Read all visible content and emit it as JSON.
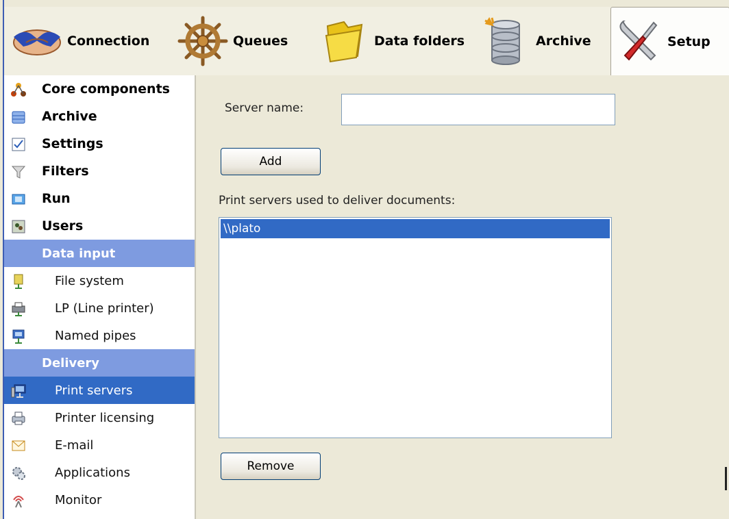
{
  "toolbar": {
    "items": [
      {
        "label": "Connection",
        "icon": "handshake-icon"
      },
      {
        "label": "Queues",
        "icon": "ship-wheel-icon"
      },
      {
        "label": "Data folders",
        "icon": "folder-icon"
      },
      {
        "label": "Archive",
        "icon": "database-icon"
      },
      {
        "label": "Setup",
        "icon": "tools-icon",
        "active": true
      }
    ]
  },
  "sidebar": {
    "items": [
      {
        "label": "Core components",
        "icon": "components-icon"
      },
      {
        "label": "Archive",
        "icon": "database-icon"
      },
      {
        "label": "Settings",
        "icon": "checkbox-icon"
      },
      {
        "label": "Filters",
        "icon": "funnel-icon"
      },
      {
        "label": "Run",
        "icon": "run-icon"
      },
      {
        "label": "Users",
        "icon": "users-icon"
      }
    ],
    "data_input": {
      "header": "Data input",
      "items": [
        {
          "label": "File system",
          "icon": "file-system-icon"
        },
        {
          "label": "LP (Line printer)",
          "icon": "line-printer-icon"
        },
        {
          "label": "Named pipes",
          "icon": "named-pipes-icon"
        }
      ]
    },
    "delivery": {
      "header": "Delivery",
      "items": [
        {
          "label": "Print servers",
          "icon": "print-server-icon",
          "selected": true
        },
        {
          "label": "Printer licensing",
          "icon": "printer-icon"
        },
        {
          "label": "E-mail",
          "icon": "envelope-icon"
        },
        {
          "label": "Applications",
          "icon": "gears-icon"
        },
        {
          "label": "Monitor",
          "icon": "monitor-icon"
        }
      ]
    }
  },
  "form": {
    "server_name_label": "Server name:",
    "server_name_value": "",
    "add_label": "Add",
    "list_label": "Print servers used to deliver documents:",
    "servers": [
      "\\\\plato"
    ],
    "remove_label": "Remove"
  },
  "colors": {
    "selection": "#316ac5",
    "section_header": "#7e9be0",
    "window_bg": "#ece9d8"
  }
}
